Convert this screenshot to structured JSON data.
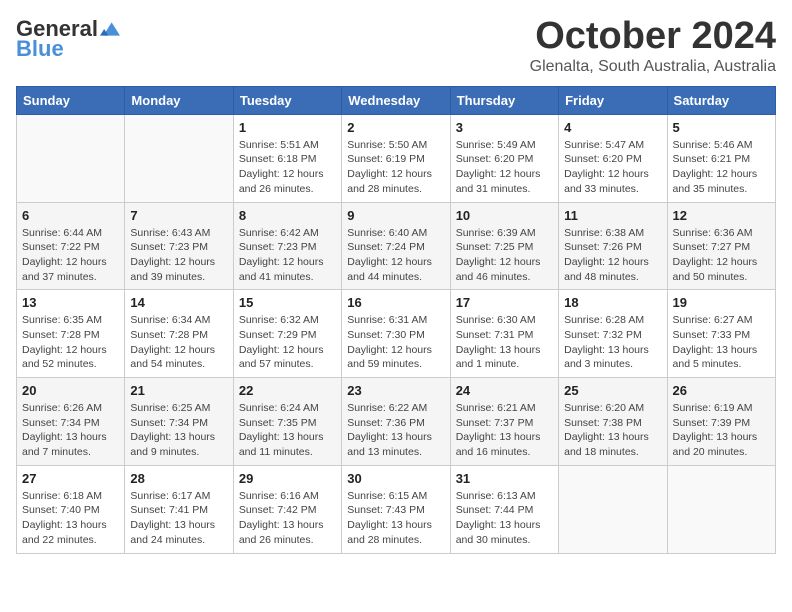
{
  "header": {
    "logo_general": "General",
    "logo_blue": "Blue",
    "month": "October 2024",
    "location": "Glenalta, South Australia, Australia"
  },
  "days_of_week": [
    "Sunday",
    "Monday",
    "Tuesday",
    "Wednesday",
    "Thursday",
    "Friday",
    "Saturday"
  ],
  "weeks": [
    [
      {
        "day": "",
        "info": ""
      },
      {
        "day": "",
        "info": ""
      },
      {
        "day": "1",
        "info": "Sunrise: 5:51 AM\nSunset: 6:18 PM\nDaylight: 12 hours\nand 26 minutes."
      },
      {
        "day": "2",
        "info": "Sunrise: 5:50 AM\nSunset: 6:19 PM\nDaylight: 12 hours\nand 28 minutes."
      },
      {
        "day": "3",
        "info": "Sunrise: 5:49 AM\nSunset: 6:20 PM\nDaylight: 12 hours\nand 31 minutes."
      },
      {
        "day": "4",
        "info": "Sunrise: 5:47 AM\nSunset: 6:20 PM\nDaylight: 12 hours\nand 33 minutes."
      },
      {
        "day": "5",
        "info": "Sunrise: 5:46 AM\nSunset: 6:21 PM\nDaylight: 12 hours\nand 35 minutes."
      }
    ],
    [
      {
        "day": "6",
        "info": "Sunrise: 6:44 AM\nSunset: 7:22 PM\nDaylight: 12 hours\nand 37 minutes."
      },
      {
        "day": "7",
        "info": "Sunrise: 6:43 AM\nSunset: 7:23 PM\nDaylight: 12 hours\nand 39 minutes."
      },
      {
        "day": "8",
        "info": "Sunrise: 6:42 AM\nSunset: 7:23 PM\nDaylight: 12 hours\nand 41 minutes."
      },
      {
        "day": "9",
        "info": "Sunrise: 6:40 AM\nSunset: 7:24 PM\nDaylight: 12 hours\nand 44 minutes."
      },
      {
        "day": "10",
        "info": "Sunrise: 6:39 AM\nSunset: 7:25 PM\nDaylight: 12 hours\nand 46 minutes."
      },
      {
        "day": "11",
        "info": "Sunrise: 6:38 AM\nSunset: 7:26 PM\nDaylight: 12 hours\nand 48 minutes."
      },
      {
        "day": "12",
        "info": "Sunrise: 6:36 AM\nSunset: 7:27 PM\nDaylight: 12 hours\nand 50 minutes."
      }
    ],
    [
      {
        "day": "13",
        "info": "Sunrise: 6:35 AM\nSunset: 7:28 PM\nDaylight: 12 hours\nand 52 minutes."
      },
      {
        "day": "14",
        "info": "Sunrise: 6:34 AM\nSunset: 7:28 PM\nDaylight: 12 hours\nand 54 minutes."
      },
      {
        "day": "15",
        "info": "Sunrise: 6:32 AM\nSunset: 7:29 PM\nDaylight: 12 hours\nand 57 minutes."
      },
      {
        "day": "16",
        "info": "Sunrise: 6:31 AM\nSunset: 7:30 PM\nDaylight: 12 hours\nand 59 minutes."
      },
      {
        "day": "17",
        "info": "Sunrise: 6:30 AM\nSunset: 7:31 PM\nDaylight: 13 hours\nand 1 minute."
      },
      {
        "day": "18",
        "info": "Sunrise: 6:28 AM\nSunset: 7:32 PM\nDaylight: 13 hours\nand 3 minutes."
      },
      {
        "day": "19",
        "info": "Sunrise: 6:27 AM\nSunset: 7:33 PM\nDaylight: 13 hours\nand 5 minutes."
      }
    ],
    [
      {
        "day": "20",
        "info": "Sunrise: 6:26 AM\nSunset: 7:34 PM\nDaylight: 13 hours\nand 7 minutes."
      },
      {
        "day": "21",
        "info": "Sunrise: 6:25 AM\nSunset: 7:34 PM\nDaylight: 13 hours\nand 9 minutes."
      },
      {
        "day": "22",
        "info": "Sunrise: 6:24 AM\nSunset: 7:35 PM\nDaylight: 13 hours\nand 11 minutes."
      },
      {
        "day": "23",
        "info": "Sunrise: 6:22 AM\nSunset: 7:36 PM\nDaylight: 13 hours\nand 13 minutes."
      },
      {
        "day": "24",
        "info": "Sunrise: 6:21 AM\nSunset: 7:37 PM\nDaylight: 13 hours\nand 16 minutes."
      },
      {
        "day": "25",
        "info": "Sunrise: 6:20 AM\nSunset: 7:38 PM\nDaylight: 13 hours\nand 18 minutes."
      },
      {
        "day": "26",
        "info": "Sunrise: 6:19 AM\nSunset: 7:39 PM\nDaylight: 13 hours\nand 20 minutes."
      }
    ],
    [
      {
        "day": "27",
        "info": "Sunrise: 6:18 AM\nSunset: 7:40 PM\nDaylight: 13 hours\nand 22 minutes."
      },
      {
        "day": "28",
        "info": "Sunrise: 6:17 AM\nSunset: 7:41 PM\nDaylight: 13 hours\nand 24 minutes."
      },
      {
        "day": "29",
        "info": "Sunrise: 6:16 AM\nSunset: 7:42 PM\nDaylight: 13 hours\nand 26 minutes."
      },
      {
        "day": "30",
        "info": "Sunrise: 6:15 AM\nSunset: 7:43 PM\nDaylight: 13 hours\nand 28 minutes."
      },
      {
        "day": "31",
        "info": "Sunrise: 6:13 AM\nSunset: 7:44 PM\nDaylight: 13 hours\nand 30 minutes."
      },
      {
        "day": "",
        "info": ""
      },
      {
        "day": "",
        "info": ""
      }
    ]
  ]
}
